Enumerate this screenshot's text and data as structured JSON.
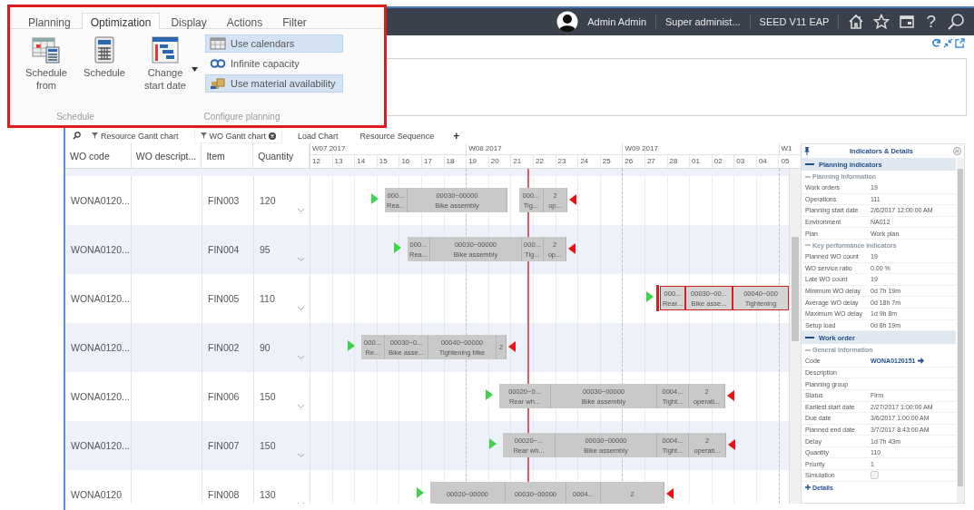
{
  "ribbon": {
    "tabs": [
      {
        "label": "Planning",
        "selected": false
      },
      {
        "label": "Optimization",
        "selected": true
      },
      {
        "label": "Display",
        "selected": false
      },
      {
        "label": "Actions",
        "selected": false
      },
      {
        "label": "Filter",
        "selected": false
      }
    ],
    "groups": [
      {
        "label": "Schedule",
        "buttons": [
          {
            "kind": "large",
            "label": "Schedule from"
          },
          {
            "kind": "large",
            "label": "Schedule"
          }
        ]
      },
      {
        "label": "Configure planning",
        "buttons": [
          {
            "kind": "dropdown",
            "label": "Change start date"
          },
          {
            "kind": "toggle",
            "label": "Use calendars",
            "on": true
          },
          {
            "kind": "toggle",
            "label": "Infinite capacity",
            "on": false
          },
          {
            "kind": "toggle",
            "label": "Use material availability",
            "on": true
          }
        ]
      }
    ]
  },
  "topbar": {
    "user": "Admin Admin",
    "role": "Super administ...",
    "environment": "SEED V11 EAP",
    "help": "?"
  },
  "view_tabs": {
    "tabs": [
      {
        "label": "Resource Gantt chart",
        "filtered": true,
        "selected": false,
        "closable": false
      },
      {
        "label": "WO Gantt chart",
        "filtered": true,
        "selected": true,
        "closable": true
      },
      {
        "label": "Load Chart",
        "filtered": false,
        "selected": false,
        "closable": false
      },
      {
        "label": "Resource Sequence",
        "filtered": false,
        "selected": false,
        "closable": false
      }
    ],
    "add": "+"
  },
  "table": {
    "columns": [
      "WO code",
      "WO descript...",
      "Item",
      "Quantity"
    ]
  },
  "gantt": {
    "weeks": [
      "W07 2017",
      "W08 2017",
      "W09 2017",
      "W1"
    ],
    "days": [
      "12",
      "13",
      "14",
      "15",
      "16",
      "17",
      "18",
      "19",
      "20",
      "21",
      "22",
      "23",
      "24",
      "25",
      "26",
      "27",
      "28",
      "01",
      "02",
      "03",
      "04",
      "05"
    ]
  },
  "rows": [
    {
      "wo_code": "WONA0120...",
      "item": "FIN003",
      "quantity": "120",
      "highlighted": false,
      "late": true,
      "segments": [
        {
          "code": "000...",
          "name": "Rea..."
        },
        {
          "code": "00030~00000",
          "name": "Bike assembly"
        },
        {
          "code": "000...",
          "name": "Tig..."
        },
        {
          "code": "2",
          "name": "op..."
        }
      ]
    },
    {
      "wo_code": "WONA0120...",
      "item": "FIN004",
      "quantity": "95",
      "highlighted": false,
      "late": true,
      "segments": [
        {
          "code": "000...",
          "name": "Rea..."
        },
        {
          "code": "00030~00000",
          "name": "Bike assembly"
        },
        {
          "code": "000...",
          "name": "Tig..."
        },
        {
          "code": "2",
          "name": "op..."
        }
      ]
    },
    {
      "wo_code": "WONA0120...",
      "item": "FIN005",
      "quantity": "110",
      "highlighted": true,
      "late": false,
      "segments": [
        {
          "code": "000...",
          "name": "Rear..."
        },
        {
          "code": "00030~00...",
          "name": "Bike asse..."
        },
        {
          "code": "00040~000",
          "name": "Tightening"
        }
      ]
    },
    {
      "wo_code": "WONA0120...",
      "item": "FIN002",
      "quantity": "90",
      "highlighted": false,
      "late": true,
      "segments": [
        {
          "code": "000...",
          "name": "Re..."
        },
        {
          "code": "00030~0...",
          "name": "Bike asse..."
        },
        {
          "code": "00040~00000",
          "name": "Tightening bike"
        },
        {
          "code": "2"
        }
      ]
    },
    {
      "wo_code": "WONA0120...",
      "item": "FIN006",
      "quantity": "150",
      "highlighted": false,
      "late": true,
      "segments": [
        {
          "code": "00020~0...",
          "name": "Rear wh..."
        },
        {
          "code": "00030~00000",
          "name": "Bike assembly"
        },
        {
          "code": "0004...",
          "name": "Tight..."
        },
        {
          "code": "2",
          "name": "operati..."
        }
      ]
    },
    {
      "wo_code": "WONA0120...",
      "item": "FIN007",
      "quantity": "150",
      "highlighted": false,
      "late": true,
      "segments": [
        {
          "code": "00020~...",
          "name": "Rear wh..."
        },
        {
          "code": "00030~00000",
          "name": "Bike assembly"
        },
        {
          "code": "0004...",
          "name": "Tight..."
        },
        {
          "code": "2",
          "name": "operati..."
        }
      ]
    },
    {
      "wo_code": "WONA0120",
      "item": "FIN008",
      "quantity": "130",
      "highlighted": false,
      "late": true,
      "segments": [
        {
          "code": "00020~00000"
        },
        {
          "code": "00030~00000"
        },
        {
          "code": "0004..."
        },
        {
          "code": "2"
        }
      ]
    }
  ],
  "details": {
    "title": "Indicators & Details",
    "sections": [
      {
        "title": "Planning indicators",
        "expanded": true,
        "groups": [
          {
            "title": "Planning information",
            "expanded": true,
            "fields": [
              {
                "kind": "text",
                "label": "Work orders",
                "value": "19"
              },
              {
                "kind": "text",
                "label": "Operations",
                "value": "111"
              },
              {
                "kind": "text",
                "label": "Planning start date",
                "value": "2/6/2017 12:00:00 AM"
              },
              {
                "kind": "text",
                "label": "Environment",
                "value": "NA012"
              },
              {
                "kind": "text",
                "label": "Plan",
                "value": "Work plan"
              }
            ]
          },
          {
            "title": "Key performance indicators",
            "expanded": true,
            "fields": [
              {
                "kind": "text",
                "label": "Planned WO count",
                "value": "19"
              },
              {
                "kind": "text",
                "label": "WO service ratio",
                "value": "0.00 %"
              },
              {
                "kind": "text",
                "label": "Late WO count",
                "value": "19"
              },
              {
                "kind": "text",
                "label": "Minimum WO delay",
                "value": "0d 7h 19m"
              },
              {
                "kind": "text",
                "label": "Average WO delay",
                "value": "0d 18h 7m"
              },
              {
                "kind": "text",
                "label": "Maximum WO delay",
                "value": "1d 9h 8m"
              },
              {
                "kind": "text",
                "label": "Setup load",
                "value": "0d 8h 19m"
              }
            ]
          }
        ]
      },
      {
        "title": "Work order",
        "expanded": true,
        "groups": [
          {
            "title": "General information",
            "expanded": true,
            "fields": [
              {
                "kind": "link",
                "label": "Code",
                "value": "WONA0120151"
              },
              {
                "kind": "text",
                "label": "Description"
              },
              {
                "kind": "text",
                "label": "Planning group"
              },
              {
                "kind": "text",
                "label": "Status",
                "value": "Firm"
              },
              {
                "kind": "text",
                "label": "Earliest start date",
                "value": "2/27/2017 1:00:00 AM"
              },
              {
                "kind": "text",
                "label": "Due date",
                "value": "3/6/2017 1:00:00 AM"
              },
              {
                "kind": "text",
                "label": "Planned end date",
                "value": "3/7/2017 8:43:00 AM"
              },
              {
                "kind": "text",
                "label": "Delay",
                "value": "1d 7h 43m"
              },
              {
                "kind": "text",
                "label": "Quantity",
                "value": "110"
              },
              {
                "kind": "text",
                "label": "Priority",
                "value": "1"
              },
              {
                "kind": "checkbox",
                "label": "Simulation",
                "checked": false
              }
            ]
          }
        ]
      }
    ],
    "more": {
      "label": "Details",
      "expanded": false
    }
  }
}
